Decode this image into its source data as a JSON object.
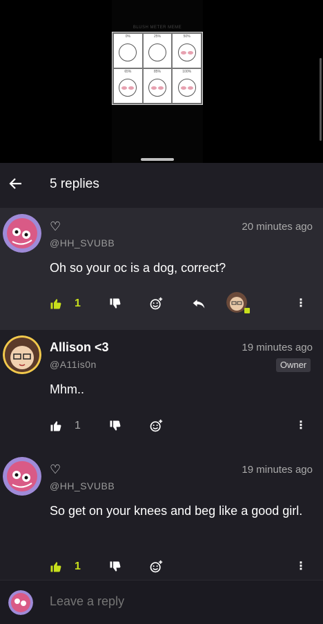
{
  "video": {
    "meme_title": "BLUSH METER MEME",
    "cells": [
      "0%",
      "25%",
      "50%",
      "65%",
      "85%",
      "100%"
    ]
  },
  "header": {
    "title": "5 replies"
  },
  "comments": [
    {
      "name": "♡",
      "handle": "@HH_SVUBB",
      "time": "20 minutes ago",
      "text": "Oh so your oc is a dog, correct?",
      "likes": "1"
    },
    {
      "name": "Allison <3",
      "handle": "@A11is0n",
      "time": "19 minutes ago",
      "badge": "Owner",
      "text": "Mhm..",
      "likes": "1"
    },
    {
      "name": "♡",
      "handle": "@HH_SVUBB",
      "time": "19 minutes ago",
      "text": "So get on your knees and beg like a good girl.",
      "likes": "1"
    }
  ],
  "reply": {
    "placeholder": "Leave a reply"
  },
  "colors": {
    "accent": "#c8e01c",
    "panel": "#1b1a21",
    "highlight": "#2b2a31"
  }
}
